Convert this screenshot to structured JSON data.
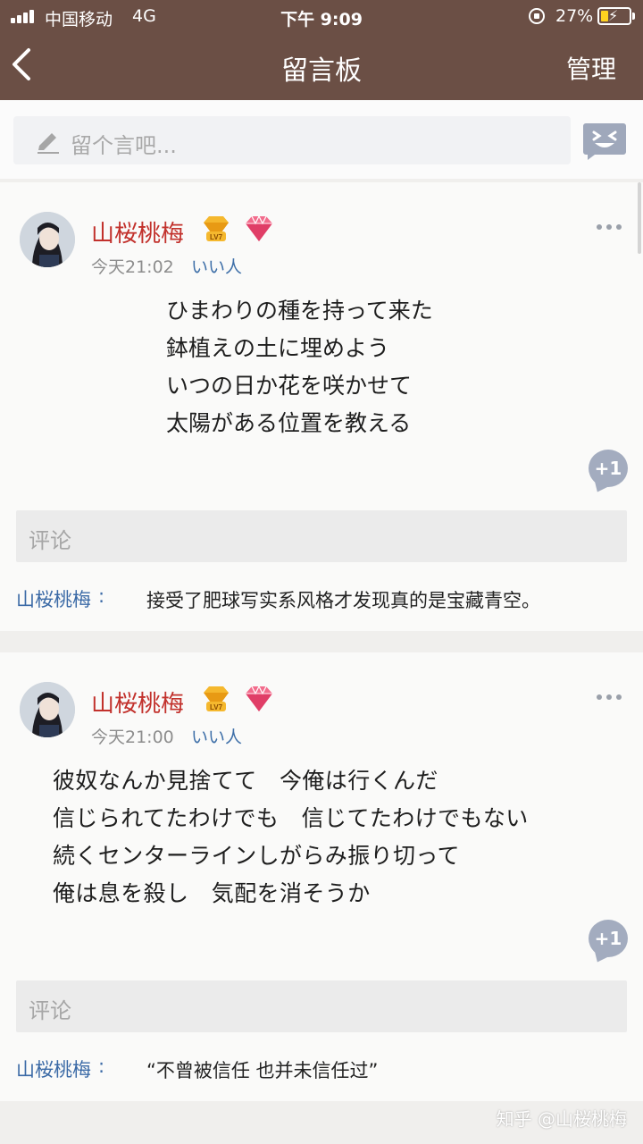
{
  "status_bar": {
    "carrier": "中国移动",
    "network": "4G",
    "time": "下午 9:09",
    "battery_percent": "27%",
    "battery_level": 0.27,
    "battery_color": "#ffd21f"
  },
  "nav": {
    "title": "留言板",
    "manage_label": "管理",
    "back_icon": "chevron-left-icon"
  },
  "composer": {
    "placeholder": "留个言吧...",
    "pencil_icon": "pencil-icon",
    "emoji_icon": "emoji-face-icon"
  },
  "posts": [
    {
      "author": "山桜桃梅",
      "level_badge": "LV7",
      "time": "今天21:02",
      "tag": "いい人",
      "lines": [
        "ひまわりの種を持って来た",
        "鉢植えの土に埋めよう",
        "いつの日か花を咲かせて",
        "太陽がある位置を教える"
      ],
      "plus_one": "+1",
      "comment_placeholder": "评论",
      "reply": {
        "author": "山桜桃梅",
        "colon": ":",
        "text": "接受了肥球写实系风格才发现真的是宝藏青空。"
      }
    },
    {
      "author": "山桜桃梅",
      "level_badge": "LV7",
      "time": "今天21:00",
      "tag": "いい人",
      "lines": [
        "彼奴なんか見捨てて　今俺は行くんだ",
        "信じられてたわけでも　信じてたわけでもない",
        "続くセンターラインしがらみ振り切って",
        "俺は息を殺し　気配を消そうか"
      ],
      "plus_one": "+1",
      "comment_placeholder": "评论",
      "reply": {
        "author": "山桜桃梅",
        "colon": ":",
        "text": "“不曾被信任 也并未信任过”"
      }
    }
  ],
  "watermark": "知乎 @山桜桃梅",
  "colors": {
    "header_bg": "#6b4f45",
    "author_red": "#c2312c",
    "link_blue": "#3e6fa8"
  }
}
